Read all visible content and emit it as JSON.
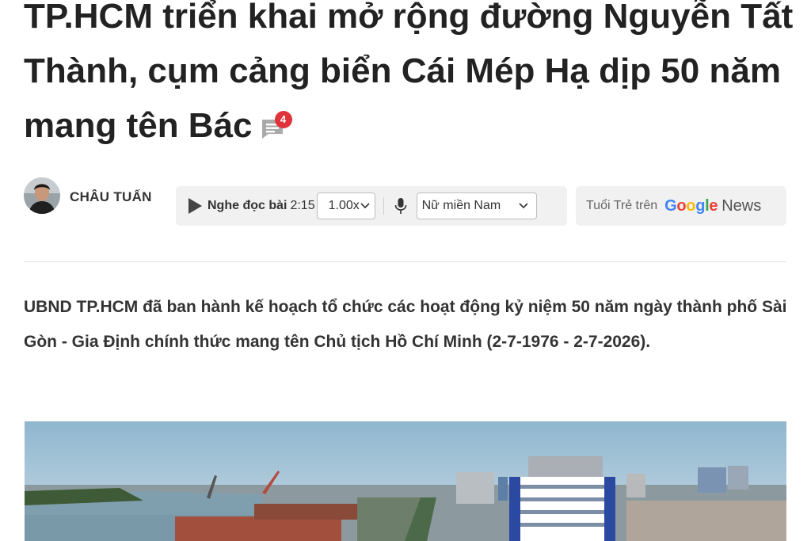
{
  "article": {
    "title": "TP.HCM triển khai mở rộng đường Nguyễn Tất Thành, cụm cảng biển Cái Mép Hạ dịp 50 năm mang tên Bác",
    "comment_count": "4",
    "author": "CHÂU TUẤN",
    "sapo": "UBND TP.HCM đã ban hành kế hoạch tổ chức các hoạt động kỷ niệm 50 năm ngày thành phố Sài Gòn - Gia Định chính thức mang tên Chủ tịch Hồ Chí Minh (2-7-1976 - 2-7-2026)."
  },
  "audio": {
    "listen_label": "Nghe đọc bài",
    "duration": "2:15",
    "speed": "1.00x",
    "voice": "Nữ miền Nam"
  },
  "google_news": {
    "prefix": "Tuổi Trẻ trên",
    "google": "Google",
    "news": "News"
  },
  "icons": {
    "comment": "comment-icon",
    "play": "play-icon",
    "mic": "microphone-icon",
    "dropdown": "chevron-down-icon"
  },
  "colors": {
    "badge": "#e0323a",
    "panel_bg": "#f1f1f1",
    "text": "#222222"
  }
}
